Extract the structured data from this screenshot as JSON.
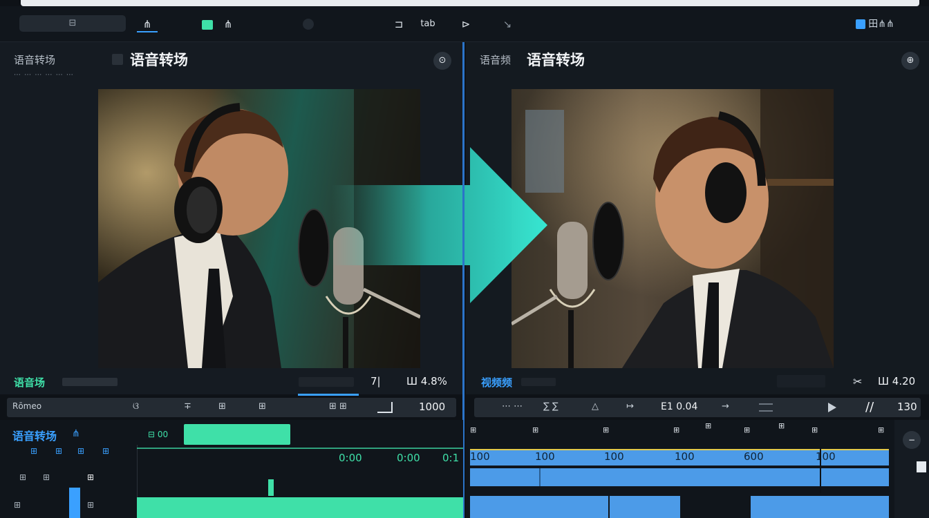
{
  "topbar": {
    "search_label": "⊟",
    "tab_1": "⋔",
    "tab_2": "⋔",
    "tool_1": "⊐",
    "tool_2": "tab",
    "tool_3": "⊳",
    "tool_4": "↘",
    "right_label": "田⋔⋔"
  },
  "left_panel": {
    "small_label": "语音转场",
    "title": "语音转场",
    "sub_text": "⋯ ⋯ ⋯ ⋯ ⋯ ⋯",
    "round_icon": "⊙",
    "bottom_label": "语音场",
    "bottom_right_1": "7|",
    "bottom_right_2": "Ш 4.8%"
  },
  "right_panel": {
    "small_label": "语音频",
    "title": "语音转场",
    "round_icon": "⊕",
    "bottom_label": "视频频",
    "bottom_right": "Ш 4.20"
  },
  "left_toolbar": {
    "label": "Rōmeo",
    "items": [
      "ଓ",
      "∓",
      "⊞",
      "⊞",
      "⊞ ⊞"
    ],
    "value": "1000"
  },
  "right_toolbar": {
    "items": [
      "⋯ ⋯",
      "∑ ∑",
      "△",
      "↦",
      "E1 0.04",
      "→"
    ],
    "value": "130"
  },
  "left_timeline": {
    "title": "语音转场",
    "title_tag": "⋔",
    "mini_tags": [
      "⊞",
      "⊞",
      "⊞",
      "⊞"
    ],
    "clip_label": "⊟ 00",
    "time_1": "0:00",
    "time_2": "0:00",
    "time_3": "0:1",
    "track_labels": [
      "⊞",
      "⊞",
      "⊞",
      "⊞",
      "⊞"
    ]
  },
  "right_timeline": {
    "ruler_labels": [
      "⊞",
      "⊞",
      "⊞",
      "⊞",
      "⊞",
      "⊞",
      "⊞",
      "⊞",
      "⊞"
    ],
    "row_values": [
      "100",
      "100",
      "100",
      "100",
      "600",
      "100"
    ]
  },
  "colors": {
    "accent_blue": "#3aa0ff",
    "accent_green": "#3fe0a8",
    "arrow_teal": "#2fd7c4",
    "clip_blue": "#4c9be8"
  }
}
